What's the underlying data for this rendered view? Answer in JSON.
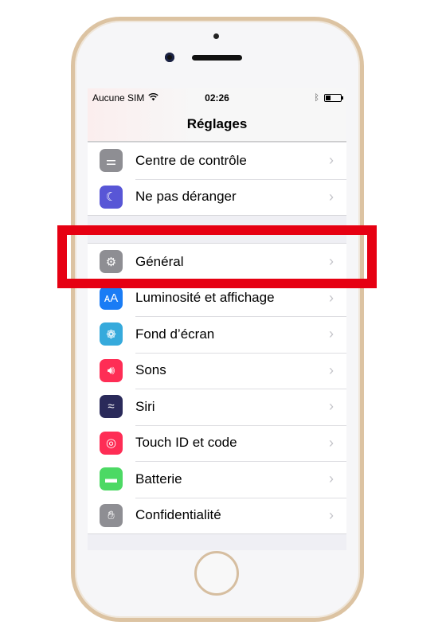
{
  "status_bar": {
    "carrier": "Aucune SIM",
    "time": "02:26",
    "wifi_icon": "wifi-icon",
    "bluetooth_icon": "bluetooth-icon",
    "battery_icon": "battery-icon"
  },
  "nav": {
    "title": "Réglages"
  },
  "groups": [
    [
      {
        "label": "Centre de contrôle",
        "icon": "control-center-icon",
        "color": "#8e8e93"
      },
      {
        "label": "Ne pas déranger",
        "icon": "moon-icon",
        "color": "#5856d6"
      }
    ],
    [
      {
        "label": "Général",
        "icon": "gear-icon",
        "color": "#8e8e93"
      },
      {
        "label": "Luminosité et affichage",
        "icon": "display-icon",
        "color": "#1a7cf5"
      },
      {
        "label": "Fond d’écran",
        "icon": "wallpaper-icon",
        "color": "#36aadc"
      },
      {
        "label": "Sons",
        "icon": "speaker-icon",
        "color": "#fe2d55"
      },
      {
        "label": "Siri",
        "icon": "siri-icon",
        "color": "#2a2a5a"
      },
      {
        "label": "Touch ID et code",
        "icon": "fingerprint-icon",
        "color": "#fe2d55"
      },
      {
        "label": "Batterie",
        "icon": "battery-icon",
        "color": "#4cd964"
      },
      {
        "label": "Confidentialité",
        "icon": "hand-icon",
        "color": "#8e8e93"
      }
    ]
  ],
  "highlight": {
    "target": "Général",
    "color": "#e60012"
  }
}
